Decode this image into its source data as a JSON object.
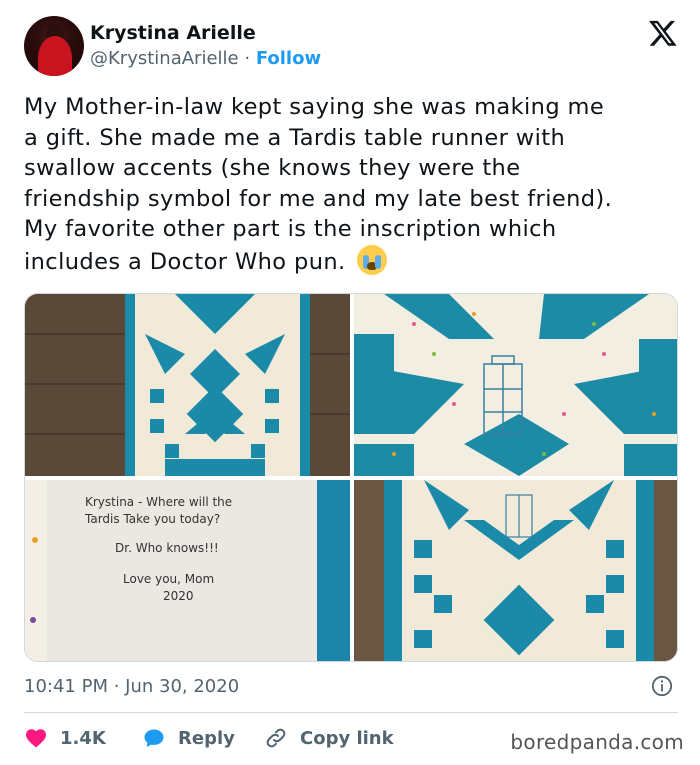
{
  "author": {
    "name": "Krystina Arielle",
    "handle": "@KrystinaArielle",
    "separator": "·",
    "follow_label": "Follow"
  },
  "tweet": {
    "lines": [
      "My Mother-in-law kept saying she was making me",
      "a gift. She made me a Tardis table runner with",
      "swallow accents (she knows they were the",
      "friendship symbol for me and my late best friend).",
      "My favorite other part is the inscription which",
      "includes a Doctor Who pun."
    ],
    "emoji": "loudly-crying-face"
  },
  "media": {
    "inscription": [
      "Krystina - Where will the",
      "Tardis Take you today?",
      "Dr. Who knows!!!",
      "Love you, Mom",
      "2020"
    ]
  },
  "meta": {
    "timestamp": "10:41 PM · Jun 30, 2020"
  },
  "actions": {
    "like_count": "1.4K",
    "reply_label": "Reply",
    "copy_label": "Copy link"
  },
  "watermark": "boredpanda.com",
  "colors": {
    "accent": "#1d9bf0",
    "like": "#f91880",
    "teal": "#1a8aa8",
    "text": "#0f1419",
    "muted": "#536471"
  }
}
